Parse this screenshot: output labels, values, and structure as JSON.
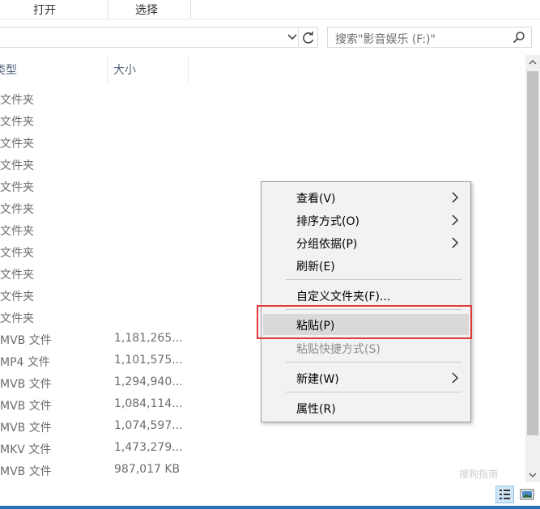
{
  "ribbon": {
    "groups": [
      "打开",
      "选择"
    ]
  },
  "address": {
    "search_placeholder": "搜索\"影音娱乐 (F:)\""
  },
  "columns": {
    "type_header": "类型",
    "size_header": "大小"
  },
  "rows": [
    {
      "type": "文件夹",
      "size": ""
    },
    {
      "type": "文件夹",
      "size": ""
    },
    {
      "type": "文件夹",
      "size": ""
    },
    {
      "type": "文件夹",
      "size": ""
    },
    {
      "type": "文件夹",
      "size": ""
    },
    {
      "type": "文件夹",
      "size": ""
    },
    {
      "type": "文件夹",
      "size": ""
    },
    {
      "type": "文件夹",
      "size": ""
    },
    {
      "type": "文件夹",
      "size": ""
    },
    {
      "type": "文件夹",
      "size": ""
    },
    {
      "type": "文件夹",
      "size": ""
    },
    {
      "type": "MVB 文件",
      "size": "1,181,265..."
    },
    {
      "type": "MP4 文件",
      "size": "1,101,575..."
    },
    {
      "type": "MVB 文件",
      "size": "1,294,940..."
    },
    {
      "type": "MVB 文件",
      "size": "1,084,114..."
    },
    {
      "type": "MVB 文件",
      "size": "1,074,597..."
    },
    {
      "type": "MKV 文件",
      "size": "1,473,279..."
    },
    {
      "type": "MVB 文件",
      "size": "987,017 KB"
    }
  ],
  "context_menu": {
    "items": [
      {
        "label": "查看(V)",
        "submenu": true
      },
      {
        "label": "排序方式(O)",
        "submenu": true
      },
      {
        "label": "分组依据(P)",
        "submenu": true
      },
      {
        "label": "刷新(E)",
        "submenu": false
      },
      {
        "label": "自定义文件夹(F)...",
        "submenu": false
      },
      {
        "label": "粘贴(P)",
        "submenu": false
      },
      {
        "label": "粘贴快捷方式(S)",
        "submenu": false,
        "disabled": true
      },
      {
        "label": "新建(W)",
        "submenu": true
      },
      {
        "label": "属性(R)",
        "submenu": false
      }
    ]
  },
  "watermark": "搜狗指南",
  "colors": {
    "highlight": "#e03a3a",
    "accent": "#2a6fb5"
  }
}
